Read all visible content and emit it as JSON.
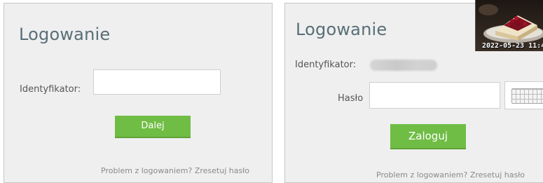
{
  "left_panel": {
    "title": "Logowanie",
    "identifier_label": "Identyfikator:",
    "next_button": "Dalej",
    "reset_link": "Problem z logowaniem? Zresetuj hasło"
  },
  "right_panel": {
    "title": "Logowanie",
    "identifier_label": "Identyfikator:",
    "password_label": "Hasło",
    "login_button": "Zaloguj",
    "reset_link": "Problem z logowaniem? Zresetuj hasło",
    "keyboard_icon": "virtual-keyboard-icon"
  },
  "photo_overlay": {
    "timestamp": "2022-05-23 11:4"
  },
  "colors": {
    "title": "#586f77",
    "button": "#70bd45",
    "panel_background": "#efefef"
  }
}
